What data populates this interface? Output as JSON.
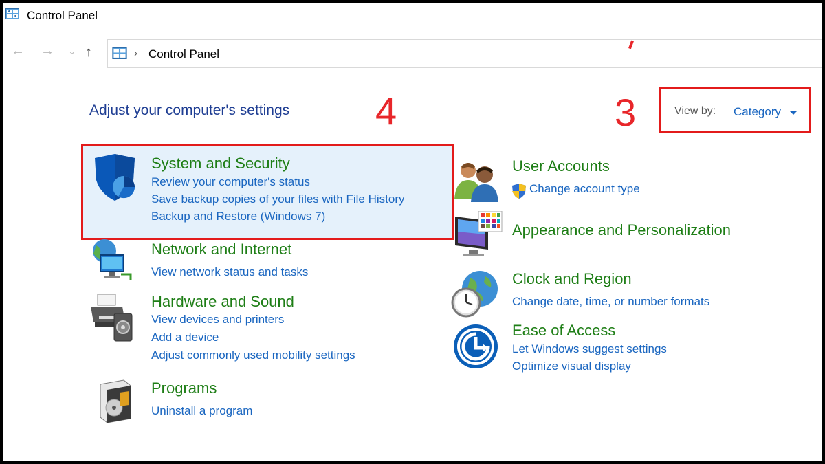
{
  "window": {
    "title": "Control Panel"
  },
  "address": {
    "separator": "›",
    "path": "Control Panel"
  },
  "nav": {
    "back": "←",
    "forward": "→",
    "dropdown": "⌄",
    "up": "↑"
  },
  "page_title": "Adjust your computer's settings",
  "markers": {
    "three": "3",
    "four": "4"
  },
  "view_by": {
    "label": "View by:",
    "value": "Category"
  },
  "categories_left": [
    {
      "title": "System and Security",
      "links": [
        "Review your computer's status",
        "Save backup copies of your files with File History",
        "Backup and Restore (Windows 7)"
      ]
    },
    {
      "title": "Network and Internet",
      "links": [
        "View network status and tasks"
      ]
    },
    {
      "title": "Hardware and Sound",
      "links": [
        "View devices and printers",
        "Add a device",
        "Adjust commonly used mobility settings"
      ]
    },
    {
      "title": "Programs",
      "links": [
        "Uninstall a program"
      ]
    }
  ],
  "categories_right": [
    {
      "title": "User Accounts",
      "links": [
        "Change account type"
      ]
    },
    {
      "title": "Appearance and Personalization",
      "links": []
    },
    {
      "title": "Clock and Region",
      "links": [
        "Change date, time, or number formats"
      ]
    },
    {
      "title": "Ease of Access",
      "links": [
        "Let Windows suggest settings",
        "Optimize visual display"
      ]
    }
  ],
  "colors": {
    "category_title": "#1e7e16",
    "link": "#1a66c0",
    "highlight_border": "#e31b1b",
    "highlight_fill": "#e5f1fb",
    "marker": "#e8262a"
  },
  "icons": [
    "control-panel-icon",
    "shield-icon",
    "network-icon",
    "printer-icon",
    "programs-icon",
    "users-icon",
    "uac-shield-icon",
    "monitor-palette-icon",
    "clock-globe-icon",
    "ease-of-access-icon"
  ]
}
